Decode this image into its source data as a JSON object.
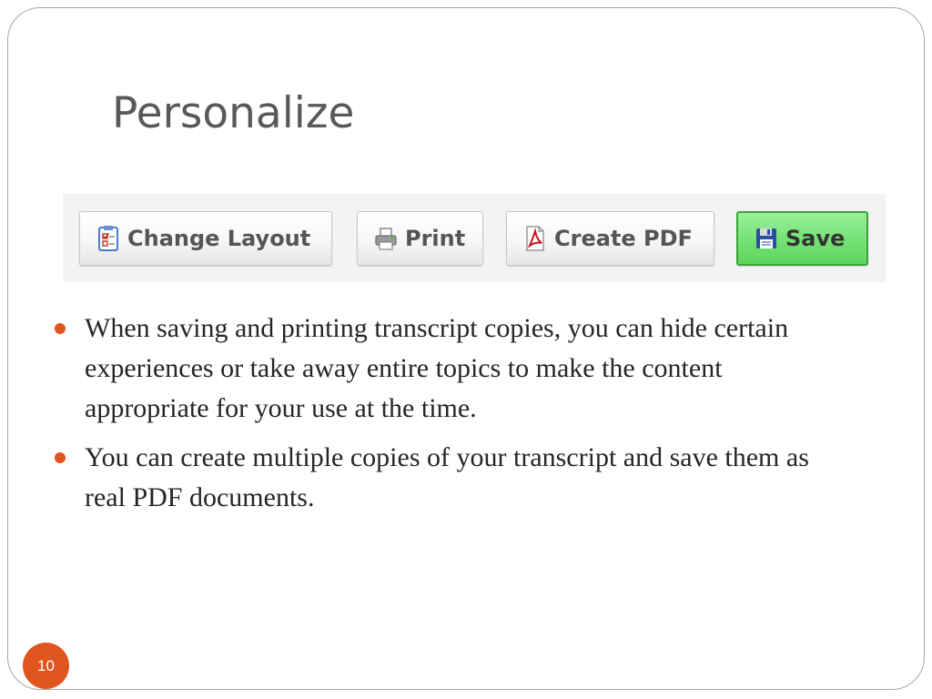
{
  "slide": {
    "title": "Personalize",
    "page_number": "10"
  },
  "toolbar": {
    "buttons": [
      {
        "label": "Change Layout",
        "icon": "checklist-icon"
      },
      {
        "label": "Print",
        "icon": "printer-icon"
      },
      {
        "label": "Create PDF",
        "icon": "pdf-icon"
      },
      {
        "label": "Save",
        "icon": "floppy-disk-icon"
      }
    ]
  },
  "bullets": [
    "When saving and printing transcript copies, you can hide certain experiences or take away entire topics to make the content appropriate for your use at the time.",
    "You can create multiple copies of your transcript and save them as real PDF documents."
  ],
  "colors": {
    "accent": "#e0541e",
    "title": "#595959",
    "save_button": "#74e174"
  }
}
